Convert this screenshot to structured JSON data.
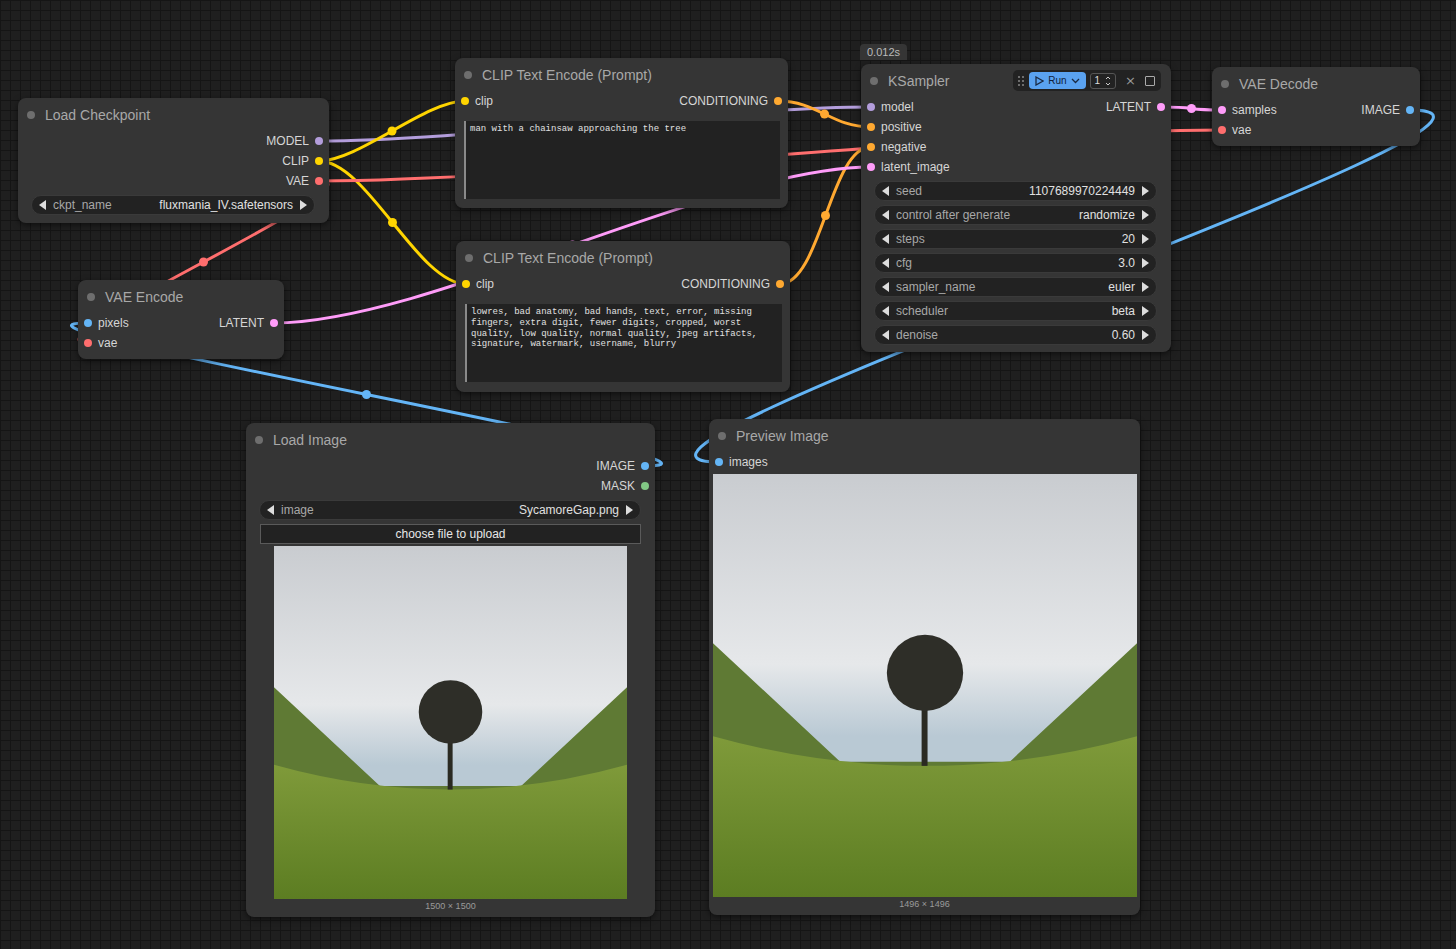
{
  "nodes": [
    {
      "kind": "widgets",
      "title": "Load Checkpoint",
      "inputs": [],
      "outputs": [
        {
          "label": "MODEL",
          "color": "#b39ddb"
        },
        {
          "label": "CLIP",
          "color": "#ffd500"
        },
        {
          "label": "VAE",
          "color": "#ff6e6e"
        }
      ],
      "widgets": [
        {
          "name": "ckpt_name",
          "value": "fluxmania_IV.safetensors"
        }
      ]
    },
    {
      "kind": "prompt",
      "title": "CLIP Text Encode (Prompt)",
      "inputs": [
        {
          "label": "clip",
          "color": "#ffd500"
        }
      ],
      "outputs": [
        {
          "label": "CONDITIONING",
          "color": "#ffa931"
        }
      ],
      "prompt": "man with a chainsaw approaching the tree"
    },
    {
      "kind": "prompt",
      "title": "CLIP Text Encode (Prompt)",
      "inputs": [
        {
          "label": "clip",
          "color": "#ffd500"
        }
      ],
      "outputs": [
        {
          "label": "CONDITIONING",
          "color": "#ffa931"
        }
      ],
      "prompt": "lowres, bad anatomy, bad hands, text, error, missing fingers, extra digit, fewer digits, cropped, worst quality, low quality, normal quality, jpeg artifacts, signature, watermark, username, blurry"
    },
    {
      "kind": "sampler",
      "title": "KSampler",
      "timing": "0.012s",
      "run": {
        "label": "Run",
        "count": "1",
        "close": "×"
      },
      "inputs": [
        {
          "label": "model",
          "color": "#b39ddb"
        },
        {
          "label": "positive",
          "color": "#ffa931"
        },
        {
          "label": "negative",
          "color": "#ffa931"
        },
        {
          "label": "latent_image",
          "color": "#ff9cf9"
        }
      ],
      "outputs": [
        {
          "label": "LATENT",
          "color": "#ff9cf9"
        }
      ],
      "widgets": [
        {
          "name": "seed",
          "value": "1107689970224449"
        },
        {
          "name": "control after generate",
          "value": "randomize"
        },
        {
          "name": "steps",
          "value": "20"
        },
        {
          "name": "cfg",
          "value": "3.0"
        },
        {
          "name": "sampler_name",
          "value": "euler"
        },
        {
          "name": "scheduler",
          "value": "beta"
        },
        {
          "name": "denoise",
          "value": "0.60"
        }
      ]
    },
    {
      "kind": "widgets",
      "title": "VAE Decode",
      "inputs": [
        {
          "label": "samples",
          "color": "#ff9cf9"
        },
        {
          "label": "vae",
          "color": "#ff6e6e"
        }
      ],
      "outputs": [
        {
          "label": "IMAGE",
          "color": "#64b5f6"
        }
      ],
      "widgets": []
    },
    {
      "kind": "widgets",
      "title": "VAE Encode",
      "inputs": [
        {
          "label": "pixels",
          "color": "#64b5f6"
        },
        {
          "label": "vae",
          "color": "#ff6e6e"
        }
      ],
      "outputs": [
        {
          "label": "LATENT",
          "color": "#ff9cf9"
        }
      ],
      "widgets": []
    },
    {
      "kind": "load-image",
      "title": "Load Image",
      "inputs": [],
      "outputs": [
        {
          "label": "IMAGE",
          "color": "#64b5f6"
        },
        {
          "label": "MASK",
          "color": "#81c784"
        }
      ],
      "widgets": [
        {
          "name": "image",
          "value": "SycamoreGap.png"
        }
      ],
      "upload": "choose file to upload",
      "image_size": "1500 × 1500"
    },
    {
      "kind": "preview",
      "title": "Preview Image",
      "inputs": [
        {
          "label": "images",
          "color": "#64b5f6"
        }
      ],
      "outputs": [],
      "widgets": [],
      "image_size": "1496 × 1496"
    }
  ]
}
